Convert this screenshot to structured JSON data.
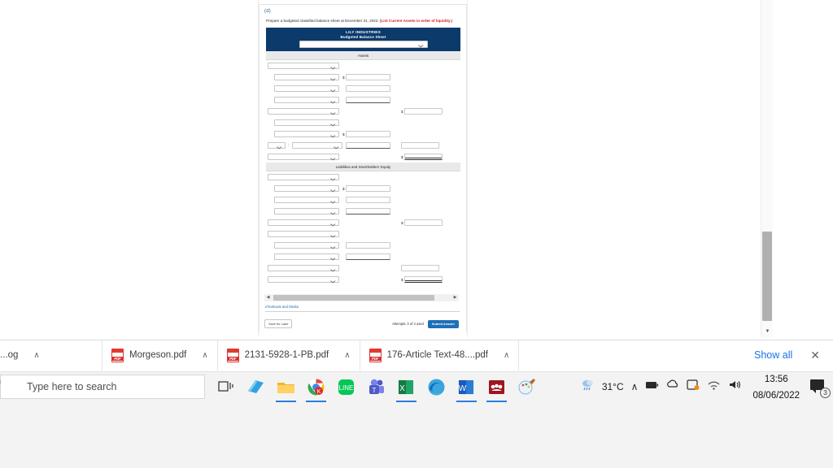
{
  "question": {
    "part_label": "(d)",
    "instruction_prefix": "Prepare a budgeted classified balance sheet at December 31, 2022.",
    "instruction_red": "(List Current Assets in order of liquidity.)"
  },
  "balance_sheet": {
    "company": "LILY INDUSTRIES",
    "statement_title": "Budgeted Balance Sheet",
    "header_select_value": "",
    "sections": [
      {
        "name": "Assets",
        "label": "Assets"
      },
      {
        "name": "liabilities",
        "label": "Liabilities and Stockholders' Equity"
      }
    ],
    "currency_symbol": "$"
  },
  "card_footer": {
    "etextbook_link": "eTextbook and Media",
    "save_later_label": "Save for Later",
    "attempts_text": "Attempts: 0 of 3 used",
    "submit_label": "Submit Answer"
  },
  "downloads_bar": {
    "items": [
      {
        "name": "...og",
        "icon": "pdf-icon"
      },
      {
        "name": "Morgeson.pdf",
        "icon": "pdf-icon"
      },
      {
        "name": "2131-5928-1-PB.pdf",
        "icon": "pdf-icon"
      },
      {
        "name": "176-Article Text-48....pdf",
        "icon": "pdf-icon"
      }
    ],
    "show_all_label": "Show all",
    "close_icon": "✕",
    "caret_icon": "∧"
  },
  "taskbar": {
    "search_placeholder": "Type here to search",
    "icons": [
      "task-view-icon",
      "sticky-notes-icon",
      "file-explorer-icon",
      "google-chrome-icon",
      "line-messenger-icon",
      "microsoft-teams-icon",
      "microsoft-excel-icon",
      "microsoft-edge-icon",
      "microsoft-word-icon",
      "mendeley-icon",
      "paint-icon"
    ],
    "tray": {
      "weather_temp": "31°C",
      "show_hidden_icon": "∧",
      "battery_icon": "battery-icon",
      "onedrive_icon": "onedrive-icon",
      "network_icon": "wifi-icon",
      "volume_icon": "speaker-icon",
      "time": "13:56",
      "date": "08/06/2022",
      "notification_count": "3"
    }
  },
  "colors": {
    "header_navy": "#0b3a6b",
    "section_gray": "#e9e9e9",
    "red_text": "#cc2027",
    "link_blue": "#1b6ca8",
    "submit_blue": "#1d6fb8",
    "chrome_blue": "#1a73e8"
  }
}
